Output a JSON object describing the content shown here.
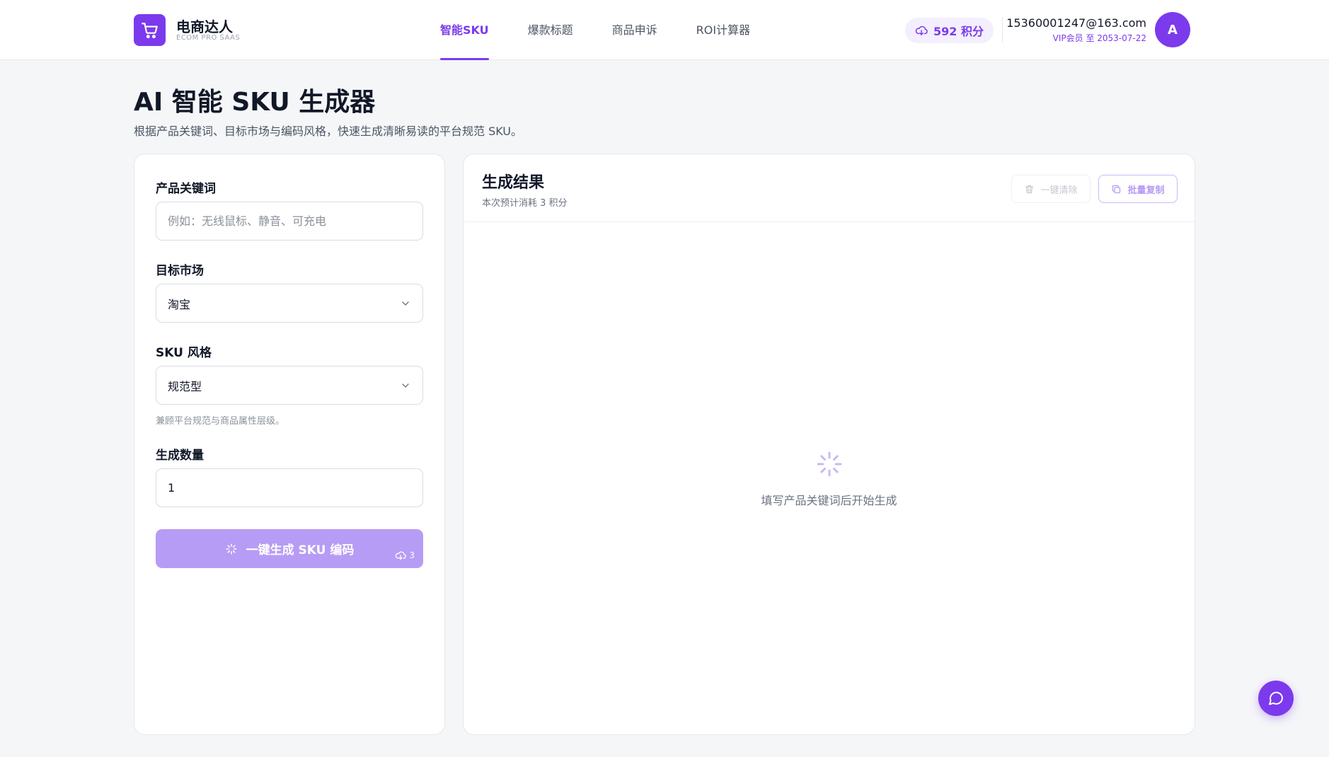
{
  "header": {
    "brand_name": "电商达人",
    "brand_sub": "ECOM PRO SAAS",
    "nav": [
      {
        "label": "智能SKU",
        "active": true
      },
      {
        "label": "爆款标题",
        "active": false
      },
      {
        "label": "商品申诉",
        "active": false
      },
      {
        "label": "ROI计算器",
        "active": false
      }
    ],
    "points": "592 积分",
    "user_email": "15360001247@163.com",
    "user_vip": "VIP会员 至 2053-07-22",
    "avatar_letter": "A"
  },
  "page": {
    "title": "AI 智能 SKU 生成器",
    "subtitle": "根据产品关键词、目标市场与编码风格，快速生成清晰易读的平台规范 SKU。"
  },
  "form": {
    "keyword_label": "产品关键词",
    "keyword_placeholder": "例如：无线鼠标、静音、可充电",
    "keyword_value": "",
    "market_label": "目标市场",
    "market_value": "淘宝",
    "style_label": "SKU 风格",
    "style_value": "规范型",
    "style_hint": "兼顾平台规范与商品属性层级。",
    "count_label": "生成数量",
    "count_value": "1",
    "generate_label": "一键生成 SKU 编码",
    "generate_cost": "3"
  },
  "result": {
    "title": "生成结果",
    "cost_note": "本次预计消耗 3 积分",
    "clear_label": "一键清除",
    "copy_label": "批量复制",
    "empty_text": "填写产品关键词后开始生成"
  },
  "icons": {
    "logo": "cart-icon",
    "points": "cloud-icon",
    "select_caret": "chevron-down-icon",
    "generate": "sparkle-icon",
    "clear": "trash-icon",
    "copy": "copy-icon",
    "empty": "loader-icon",
    "chat": "chat-bubble-icon"
  },
  "colors": {
    "accent": "#7c3aed",
    "accent_disabled": "#b79cf5",
    "accent_soft": "#f3effe"
  }
}
